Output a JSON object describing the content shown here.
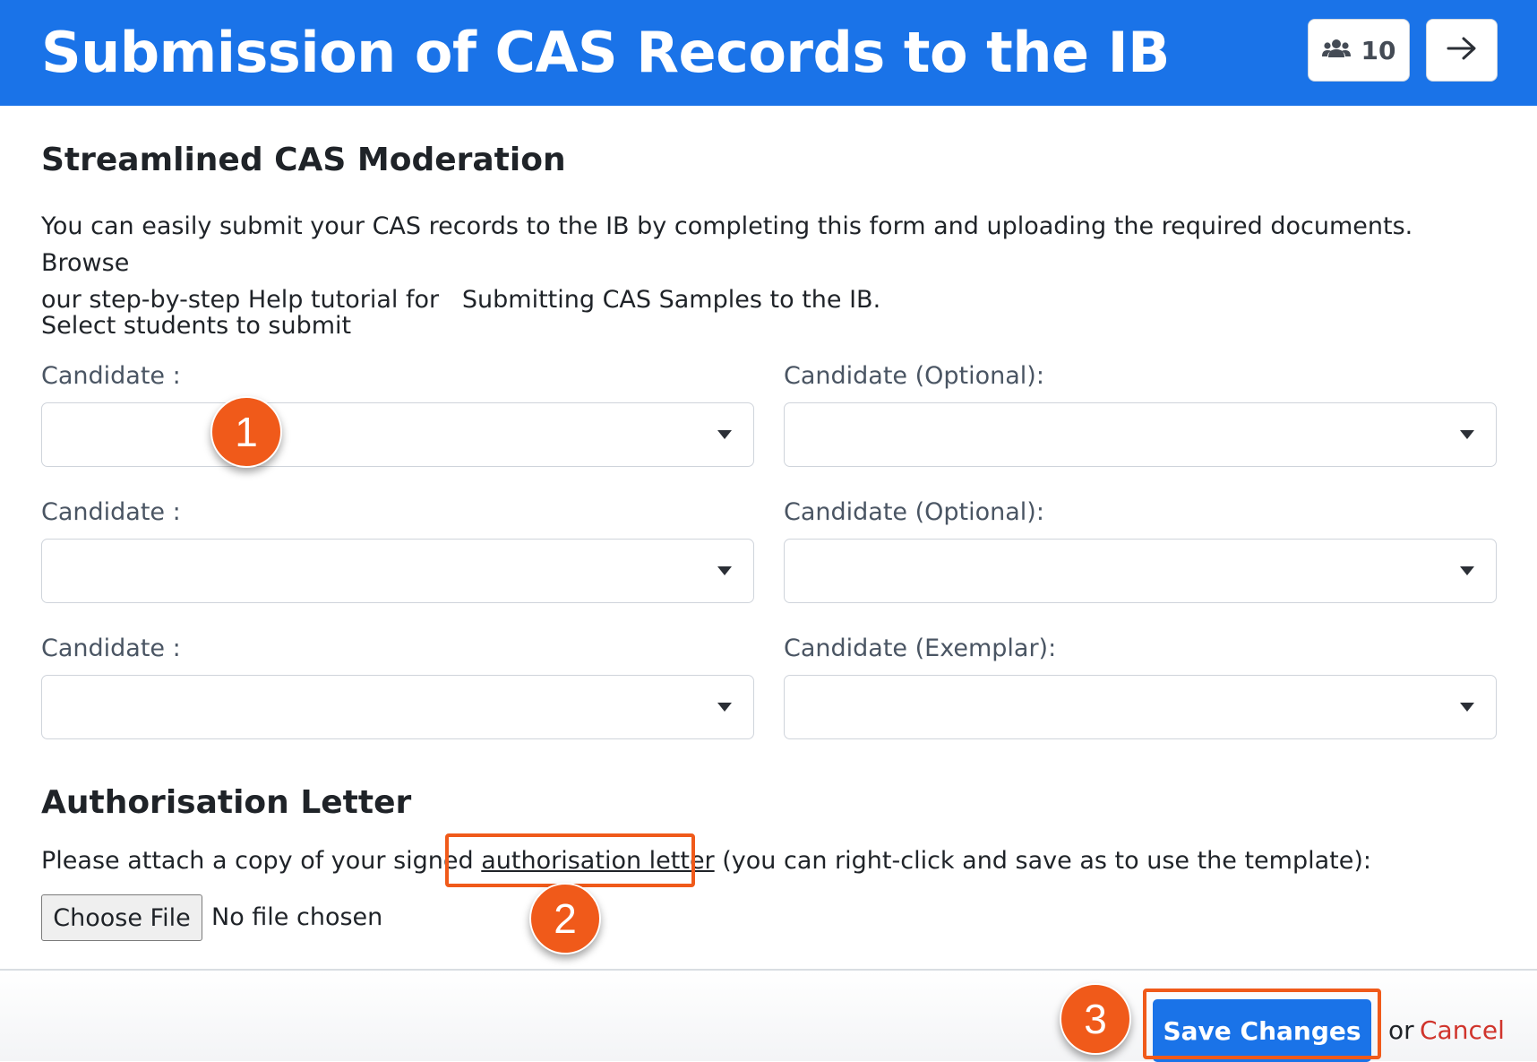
{
  "header": {
    "title": "Submission of CAS Records to the IB",
    "member_count": "10",
    "members_icon": "users-icon",
    "next_icon": "arrow-right-icon",
    "background_color": "#1a73e8"
  },
  "moderation": {
    "title": "Streamlined CAS Moderation",
    "intro_line1": "You can easily submit your CAS records to the IB by completing this form and uploading the required documents. Browse",
    "intro_line2": "our step-by-step Help tutorial for   Submitting CAS Samples to the IB.",
    "select_prompt": "Select students to submit",
    "selects": [
      {
        "label": "Candidate :",
        "value": ""
      },
      {
        "label": "Candidate (Optional):",
        "value": ""
      },
      {
        "label": "Candidate :",
        "value": ""
      },
      {
        "label": "Candidate (Optional):",
        "value": ""
      },
      {
        "label": "Candidate :",
        "value": ""
      },
      {
        "label": "Candidate (Exemplar):",
        "value": ""
      }
    ]
  },
  "authorisation": {
    "title": "Authorisation Letter",
    "text_before": "Please attach a copy of your signed",
    "link_text": "authorisation letter",
    "text_after": "(you can right-click and save as to use the template):",
    "choose_file_label": "Choose File",
    "file_status": "No file chosen"
  },
  "footer": {
    "save_label": "Save Changes",
    "or_text": "or",
    "cancel_label": "Cancel",
    "cancel_color": "#d0342c"
  },
  "annotations": {
    "badges": [
      "1",
      "2",
      "3"
    ],
    "color": "#f05a1a"
  }
}
